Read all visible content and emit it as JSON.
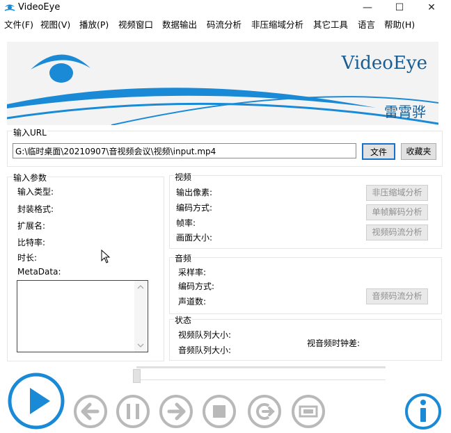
{
  "window": {
    "title": "VideoEye",
    "minimize": "—",
    "maximize": "☐",
    "close": "✕"
  },
  "menu": [
    "文件(F)",
    "视图(V)",
    "播放(P)",
    "视频窗口",
    "数据输出",
    "码流分析",
    "非压缩域分析",
    "其它工具",
    "语言",
    "帮助(H)"
  ],
  "banner": {
    "title": "VideoEye",
    "subtitle": "雷霄骅"
  },
  "url_group": {
    "label": "输入URL",
    "value": "G:\\临时桌面\\20210907\\音视频会议\\视频\\input.mp4",
    "file_button": "文件",
    "favorites_button": "收藏夹"
  },
  "input_params": {
    "label": "输入参数",
    "fields": [
      "输入类型:",
      "封装格式:",
      "扩展名:",
      "比特率:",
      "时长:",
      "MetaData:"
    ]
  },
  "video": {
    "label": "视频",
    "fields": [
      "输出像素:",
      "编码方式:",
      "帧率:",
      "画面大小:"
    ],
    "buttons": [
      "非压缩域分析",
      "单帧解码分析",
      "视频码流分析"
    ]
  },
  "audio": {
    "label": "音频",
    "fields": [
      "采样率:",
      "编码方式:",
      "声道数:"
    ],
    "button": "音频码流分析"
  },
  "status": {
    "label": "状态",
    "video_queue": "视频队列大小:",
    "audio_queue": "音频队列大小:",
    "av_diff": "视音频时钟差:"
  },
  "colors": {
    "accent": "#1a8ad6",
    "control_gray": "#b9b9b9",
    "banner_blue": "#1a5d92"
  },
  "controls": [
    "play-icon",
    "back-arrow-icon",
    "pause-icon",
    "forward-arrow-icon",
    "stop-icon",
    "loop-icon",
    "fullscreen-icon",
    "info-icon"
  ]
}
